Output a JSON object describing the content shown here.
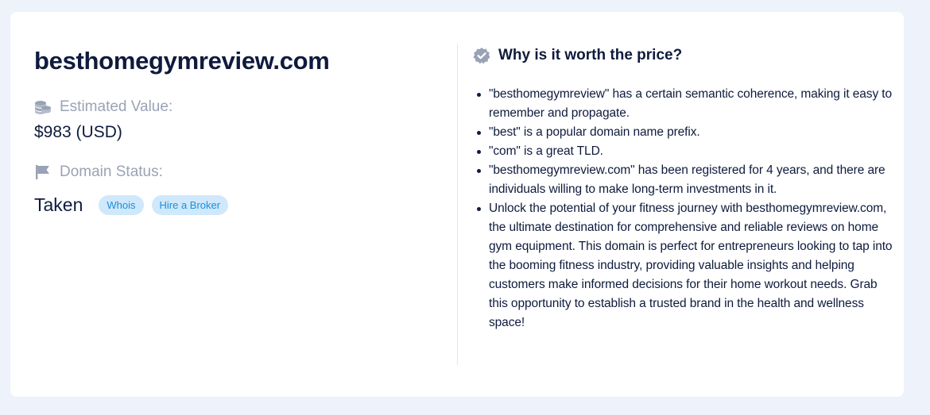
{
  "domain": "besthomegymreview.com",
  "estimated": {
    "icon": "coins-icon",
    "label": "Estimated Value:",
    "value": "$983 (USD)"
  },
  "status": {
    "icon": "flag-icon",
    "label": "Domain Status:",
    "value": "Taken",
    "actions": [
      "Whois",
      "Hire a Broker"
    ]
  },
  "why": {
    "icon": "verified-badge-icon",
    "title": "Why is it worth the price?",
    "reasons": [
      "\"besthomegymreview\" has a certain semantic coherence, making it easy to remember and propagate.",
      "\"best\" is a popular domain name prefix.",
      "\"com\" is a great TLD.",
      "\"besthomegymreview.com\" has been registered for 4 years, and there are individuals willing to make long-term investments in it.",
      "Unlock the potential of your fitness journey with besthomegymreview.com, the ultimate destination for comprehensive and reliable reviews on home gym equipment. This domain is perfect for entrepreneurs looking to tap into the booming fitness industry, providing valuable insights and helping customers make informed decisions for their home workout needs. Grab this opportunity to establish a trusted brand in the health and wellness space!"
    ]
  },
  "colors": {
    "page_bg": "#edf2fb",
    "text_dark": "#0f1b3d",
    "muted": "#9aa3b5",
    "pill_bg": "#cfe8fb",
    "pill_text": "#1b8fd6"
  }
}
